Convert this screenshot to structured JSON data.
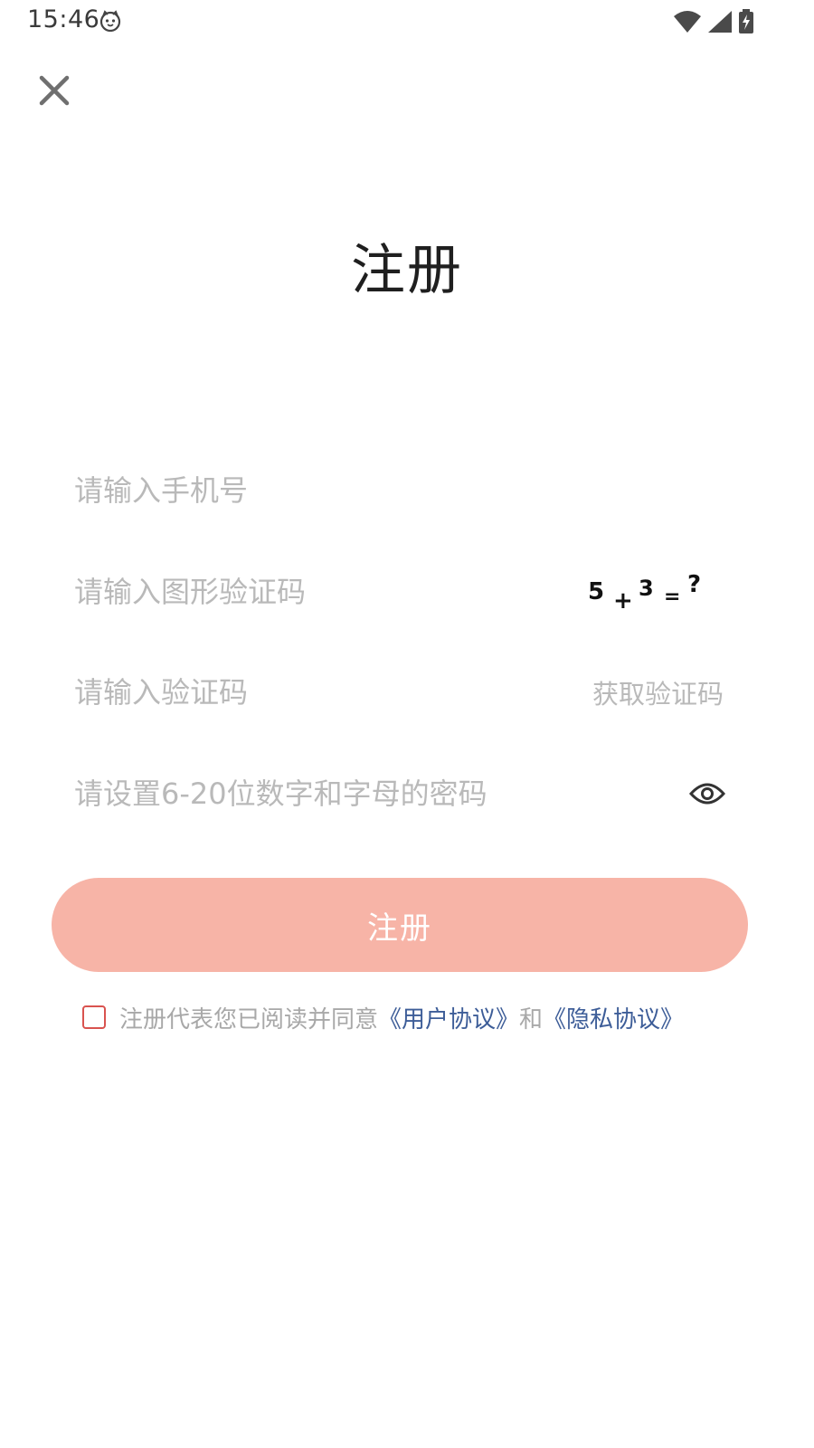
{
  "status_bar": {
    "time": "15:46",
    "app_icon": "cat-face-icon",
    "icons": [
      "wifi-icon",
      "cell-signal-icon",
      "battery-charging-icon"
    ]
  },
  "header": {
    "close_icon": "close-icon",
    "title": "注册"
  },
  "form": {
    "phone_placeholder": "请输入手机号",
    "captcha_placeholder": "请输入图形验证码",
    "captcha_image_text": "5+3=?",
    "sms_code_placeholder": "请输入验证码",
    "sms_button_label": "获取验证码",
    "password_placeholder": "请设置6-20位数字和字母的密码",
    "password_toggle_icon": "eye-icon",
    "submit_label": "注册"
  },
  "agreement": {
    "prefix": "注册代表您已阅读并同意",
    "user_agreement": "《用户协议》",
    "conjunction": "和",
    "privacy_agreement": "《隐私协议》"
  },
  "colors": {
    "button_bg": "#f7b4a7",
    "link": "#3d5d98",
    "checkbox_border": "#d9534f",
    "placeholder": "#b9b9b9"
  }
}
